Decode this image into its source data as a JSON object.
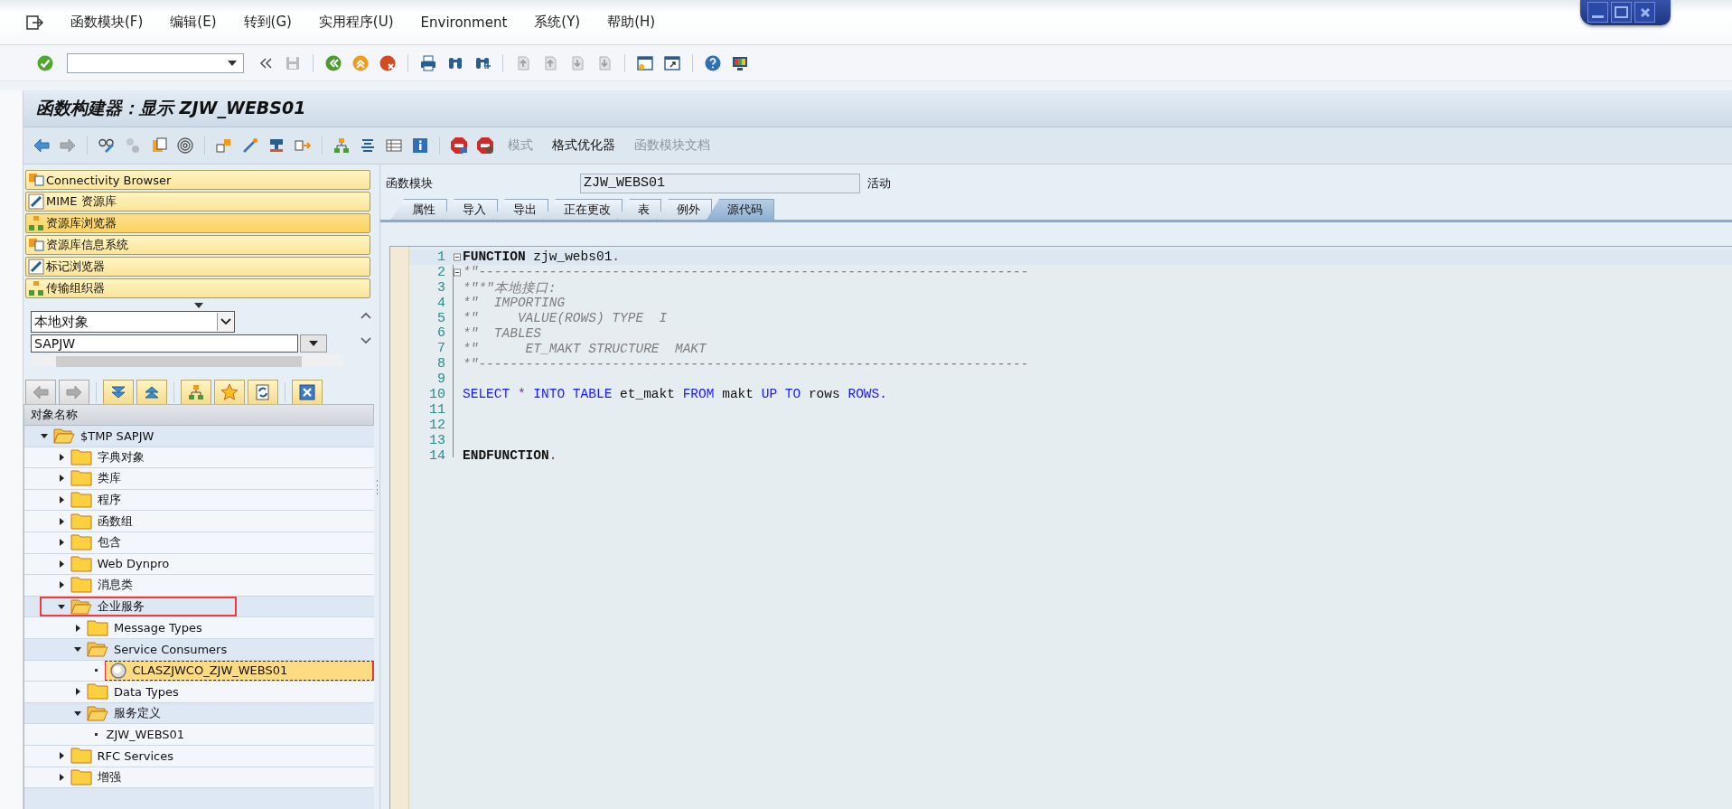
{
  "menu_bar": [
    "函数模块(F)",
    "编辑(E)",
    "转到(G)",
    "实用程序(U)",
    "Environment",
    "系统(Y)",
    "帮助(H)"
  ],
  "system_toolbar": [
    {
      "kind": "check",
      "disabled": false
    },
    {
      "kind": "command-field"
    },
    {
      "kind": "double-chevron",
      "disabled": false
    },
    {
      "kind": "save",
      "disabled": true
    },
    {
      "kind": "separator"
    },
    {
      "kind": "back",
      "disabled": false
    },
    {
      "kind": "exit",
      "disabled": false
    },
    {
      "kind": "cancel",
      "disabled": false
    },
    {
      "kind": "separator"
    },
    {
      "kind": "print",
      "disabled": false
    },
    {
      "kind": "find",
      "disabled": false
    },
    {
      "kind": "find-next",
      "disabled": false
    },
    {
      "kind": "separator"
    },
    {
      "kind": "page-first",
      "disabled": true
    },
    {
      "kind": "page-up",
      "disabled": true
    },
    {
      "kind": "page-down",
      "disabled": true
    },
    {
      "kind": "page-last",
      "disabled": true
    },
    {
      "kind": "separator"
    },
    {
      "kind": "new-window",
      "disabled": false
    },
    {
      "kind": "shortcut",
      "disabled": false
    },
    {
      "kind": "separator"
    },
    {
      "kind": "help",
      "disabled": false
    },
    {
      "kind": "monitor",
      "disabled": false
    }
  ],
  "title": "函数构建器：显示 ZJW_WEBS01",
  "app_toolbar": [
    {
      "kind": "arrow-left",
      "disabled": false
    },
    {
      "kind": "arrow-right",
      "disabled": true
    },
    {
      "kind": "separator"
    },
    {
      "kind": "glasses",
      "disabled": false
    },
    {
      "kind": "circles",
      "disabled": true
    },
    {
      "kind": "clipboard",
      "disabled": false
    },
    {
      "kind": "spiral",
      "disabled": false
    },
    {
      "kind": "separator"
    },
    {
      "kind": "blocks",
      "disabled": false
    },
    {
      "kind": "wand",
      "disabled": false
    },
    {
      "kind": "stamp",
      "disabled": false
    },
    {
      "kind": "share",
      "disabled": false
    },
    {
      "kind": "separator"
    },
    {
      "kind": "hierarchy",
      "disabled": false
    },
    {
      "kind": "list-lines",
      "disabled": false
    },
    {
      "kind": "table",
      "disabled": false
    },
    {
      "kind": "info",
      "disabled": false
    },
    {
      "kind": "separator"
    },
    {
      "kind": "stop-screen",
      "disabled": false
    },
    {
      "kind": "stop-user",
      "disabled": false
    },
    {
      "kind": "text",
      "label": "模式",
      "disabled": true
    },
    {
      "kind": "text",
      "label": "格式优化器",
      "disabled": false
    },
    {
      "kind": "text",
      "label": "函数模块文档",
      "disabled": true
    }
  ],
  "navigation_buttons": [
    {
      "label": "Connectivity Browser",
      "selected": false
    },
    {
      "label": "MIME 资源库",
      "selected": false
    },
    {
      "label": "资源库浏览器",
      "selected": true
    },
    {
      "label": "资源库信息系统",
      "selected": false
    },
    {
      "label": "标记浏览器",
      "selected": false
    },
    {
      "label": "传输组织器",
      "selected": false
    }
  ],
  "object_selector": {
    "type_dropdown": {
      "value": "本地对象"
    },
    "name_field": {
      "value": "SAPJW"
    }
  },
  "tree_toolbar": [
    {
      "kind": "arrow-left",
      "disabled": true
    },
    {
      "kind": "arrow-right",
      "disabled": true
    },
    {
      "kind": "separator"
    },
    {
      "kind": "expand-all",
      "disabled": false
    },
    {
      "kind": "collapse-all",
      "disabled": false
    },
    {
      "kind": "separator"
    },
    {
      "kind": "hierarchy",
      "disabled": false
    },
    {
      "kind": "star",
      "disabled": false
    },
    {
      "kind": "refresh",
      "disabled": false
    },
    {
      "kind": "separator"
    },
    {
      "kind": "close-box",
      "disabled": false
    }
  ],
  "tree": {
    "header": "对象名称",
    "nodes": [
      {
        "label": "$TMP SAPJW",
        "kind": "folder",
        "expanded": true,
        "selected": false,
        "marked": false,
        "children": [
          {
            "label": "字典对象",
            "kind": "folder",
            "expanded": false,
            "selected": false,
            "marked": false
          },
          {
            "label": "类库",
            "kind": "folder",
            "expanded": false,
            "selected": false,
            "marked": false
          },
          {
            "label": "程序",
            "kind": "folder",
            "expanded": false,
            "selected": false,
            "marked": false
          },
          {
            "label": "函数组",
            "kind": "folder",
            "expanded": false,
            "selected": false,
            "marked": false
          },
          {
            "label": "包含",
            "kind": "folder",
            "expanded": false,
            "selected": false,
            "marked": false
          },
          {
            "label": "Web Dynpro",
            "kind": "folder",
            "expanded": false,
            "selected": false,
            "marked": false
          },
          {
            "label": "消息类",
            "kind": "folder",
            "expanded": false,
            "selected": false,
            "marked": false
          },
          {
            "label": "企业服务",
            "kind": "folder",
            "expanded": true,
            "selected": false,
            "marked": true,
            "children": [
              {
                "label": "Message Types",
                "kind": "folder",
                "expanded": false,
                "selected": false,
                "marked": false
              },
              {
                "label": "Service Consumers",
                "kind": "folder",
                "expanded": true,
                "selected": false,
                "marked": false,
                "children": [
                  {
                    "label": "CLASZJWCO_ZJW_WEBS01",
                    "kind": "object",
                    "selected": true,
                    "marked": false
                  }
                ]
              },
              {
                "label": "Data Types",
                "kind": "folder",
                "expanded": false,
                "selected": false,
                "marked": false
              },
              {
                "label": "服务定义",
                "kind": "folder",
                "expanded": true,
                "selected": false,
                "marked": false,
                "children": [
                  {
                    "label": "ZJW_WEBS01",
                    "kind": "leaf",
                    "selected": false,
                    "marked": false
                  }
                ]
              }
            ]
          },
          {
            "label": "RFC Services",
            "kind": "folder",
            "expanded": false,
            "selected": false,
            "marked": false
          },
          {
            "label": "增强",
            "kind": "folder",
            "expanded": false,
            "selected": false,
            "marked": false
          }
        ]
      }
    ]
  },
  "function_module": {
    "label": "函数模块",
    "value": "ZJW_WEBS01",
    "status": "活动"
  },
  "tabs": [
    {
      "label": "属性",
      "selected": false
    },
    {
      "label": "导入",
      "selected": false
    },
    {
      "label": "导出",
      "selected": false
    },
    {
      "label": "正在更改",
      "selected": false
    },
    {
      "label": "表",
      "selected": false
    },
    {
      "label": "例外",
      "selected": false
    },
    {
      "label": "源代码",
      "selected": true
    }
  ],
  "editor": {
    "lines": [
      {
        "number": "1",
        "current": true,
        "fold": true,
        "tokens": [
          {
            "text": "FUNCTION",
            "kind": "block"
          },
          {
            "text": " zjw_webs01",
            "kind": "plain"
          },
          {
            "text": ".",
            "kind": "operator"
          }
        ]
      },
      {
        "number": "2",
        "current": false,
        "fold": true,
        "tokens": [
          {
            "text": "*\"----------------------------------------------------------------------",
            "kind": "comment"
          }
        ]
      },
      {
        "number": "3",
        "current": false,
        "fold": false,
        "tokens": [
          {
            "text": "*\"*\"本地接口:",
            "kind": "comment"
          }
        ]
      },
      {
        "number": "4",
        "current": false,
        "fold": false,
        "tokens": [
          {
            "text": "*\"  IMPORTING",
            "kind": "comment"
          }
        ]
      },
      {
        "number": "5",
        "current": false,
        "fold": false,
        "tokens": [
          {
            "text": "*\"     VALUE(ROWS) TYPE  I",
            "kind": "comment"
          }
        ]
      },
      {
        "number": "6",
        "current": false,
        "fold": false,
        "tokens": [
          {
            "text": "*\"  TABLES",
            "kind": "comment"
          }
        ]
      },
      {
        "number": "7",
        "current": false,
        "fold": false,
        "tokens": [
          {
            "text": "*\"      ET_MAKT STRUCTURE  MAKT",
            "kind": "comment"
          }
        ]
      },
      {
        "number": "8",
        "current": false,
        "fold": false,
        "tokens": [
          {
            "text": "*\"----------------------------------------------------------------------",
            "kind": "comment"
          }
        ]
      },
      {
        "number": "9",
        "current": false,
        "fold": false
      },
      {
        "number": "10",
        "current": false,
        "fold": false,
        "tokens": [
          {
            "text": "SELECT ",
            "kind": "keyword"
          },
          {
            "text": "* ",
            "kind": "operator"
          },
          {
            "text": "INTO TABLE",
            "kind": "keyword"
          },
          {
            "text": " et_makt ",
            "kind": "plain"
          },
          {
            "text": "FROM",
            "kind": "keyword"
          },
          {
            "text": " makt ",
            "kind": "plain"
          },
          {
            "text": "UP TO",
            "kind": "keyword"
          },
          {
            "text": " rows ",
            "kind": "plain"
          },
          {
            "text": "ROWS.",
            "kind": "keyword"
          }
        ]
      },
      {
        "number": "11",
        "current": false,
        "fold": false
      },
      {
        "number": "12",
        "current": false,
        "fold": false
      },
      {
        "number": "13",
        "current": false,
        "fold": false
      },
      {
        "number": "14",
        "current": false,
        "fold": false,
        "tokens": [
          {
            "text": "ENDFUNCTION",
            "kind": "block"
          },
          {
            "text": ".",
            "kind": "operator"
          }
        ]
      }
    ]
  }
}
